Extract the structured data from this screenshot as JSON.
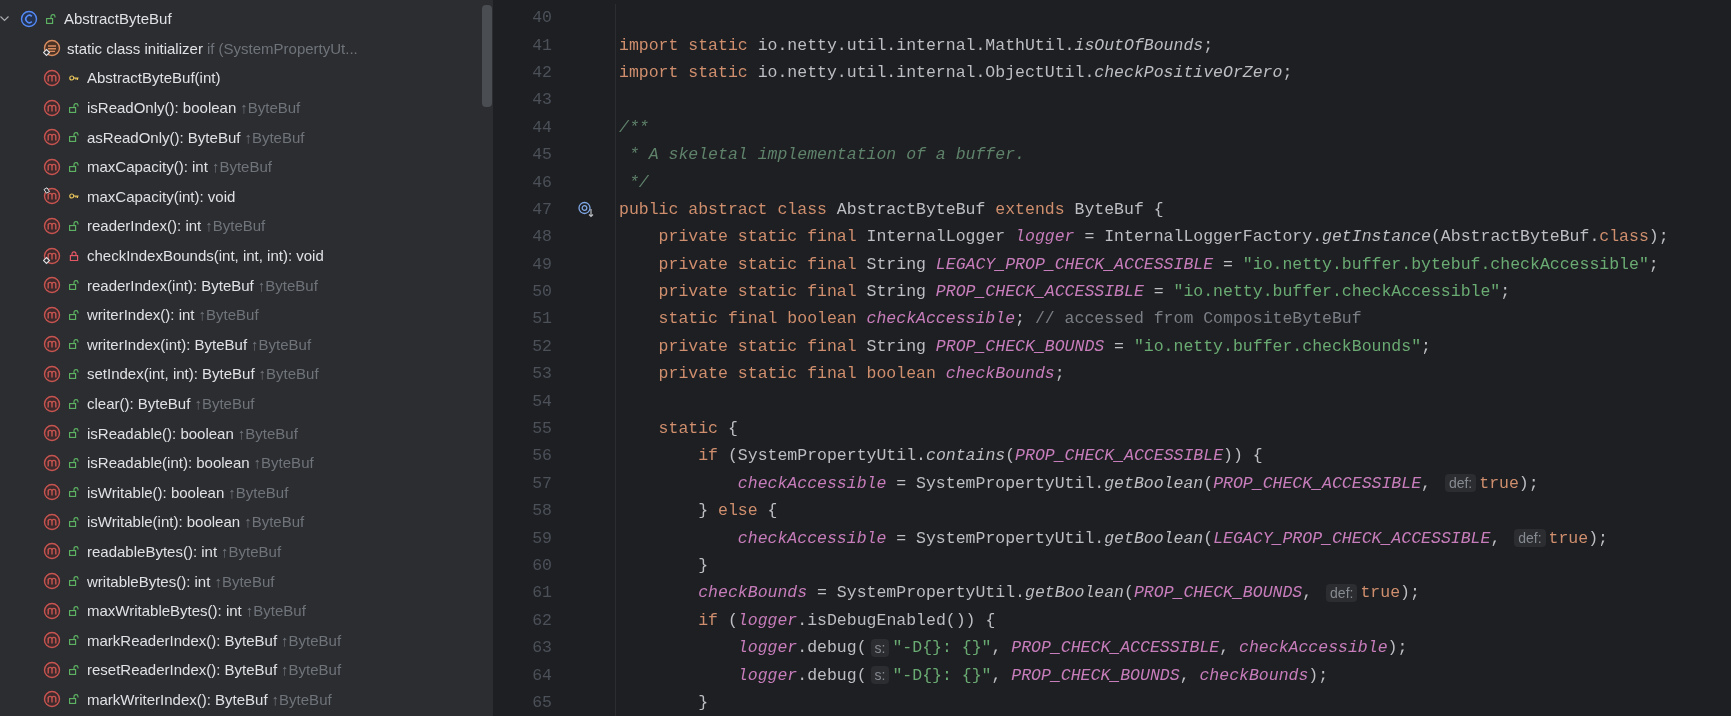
{
  "structure": {
    "root": {
      "name": "AbstractByteBuf",
      "kind": "class",
      "public": true,
      "private": false,
      "expanded": true,
      "children": [
        {
          "name": "static class initializer",
          "kind": "initializer",
          "static": true,
          "pinned": false,
          "detail": "if (SystemPropertyUt..."
        },
        {
          "name": "AbstractByteBuf(int)",
          "kind": "method",
          "public": false,
          "private": false,
          "static": false,
          "pinned": false
        },
        {
          "name": "isReadOnly(): boolean",
          "kind": "method",
          "public": true,
          "private": false,
          "static": false,
          "pinned": false,
          "detail": "↑ByteBuf"
        },
        {
          "name": "asReadOnly(): ByteBuf",
          "kind": "method",
          "public": true,
          "private": false,
          "static": false,
          "pinned": false,
          "detail": "↑ByteBuf"
        },
        {
          "name": "maxCapacity(): int",
          "kind": "method",
          "public": true,
          "private": false,
          "static": false,
          "pinned": false,
          "detail": "↑ByteBuf"
        },
        {
          "name": "maxCapacity(int): void",
          "kind": "method",
          "public": false,
          "private": false,
          "static": false,
          "pinned": true
        },
        {
          "name": "readerIndex(): int",
          "kind": "method",
          "public": true,
          "private": false,
          "static": false,
          "pinned": false,
          "detail": "↑ByteBuf"
        },
        {
          "name": "checkIndexBounds(int, int, int): void",
          "kind": "method",
          "public": false,
          "private": true,
          "static": true,
          "pinned": false
        },
        {
          "name": "readerIndex(int): ByteBuf",
          "kind": "method",
          "public": true,
          "private": false,
          "static": false,
          "pinned": false,
          "detail": "↑ByteBuf"
        },
        {
          "name": "writerIndex(): int",
          "kind": "method",
          "public": true,
          "private": false,
          "static": false,
          "pinned": false,
          "detail": "↑ByteBuf"
        },
        {
          "name": "writerIndex(int): ByteBuf",
          "kind": "method",
          "public": true,
          "private": false,
          "static": false,
          "pinned": false,
          "detail": "↑ByteBuf"
        },
        {
          "name": "setIndex(int, int): ByteBuf",
          "kind": "method",
          "public": true,
          "private": false,
          "static": false,
          "pinned": false,
          "detail": "↑ByteBuf"
        },
        {
          "name": "clear(): ByteBuf",
          "kind": "method",
          "public": true,
          "private": false,
          "static": false,
          "pinned": false,
          "detail": "↑ByteBuf"
        },
        {
          "name": "isReadable(): boolean",
          "kind": "method",
          "public": true,
          "private": false,
          "static": false,
          "pinned": false,
          "detail": "↑ByteBuf"
        },
        {
          "name": "isReadable(int): boolean",
          "kind": "method",
          "public": true,
          "private": false,
          "static": false,
          "pinned": false,
          "detail": "↑ByteBuf"
        },
        {
          "name": "isWritable(): boolean",
          "kind": "method",
          "public": true,
          "private": false,
          "static": false,
          "pinned": false,
          "detail": "↑ByteBuf"
        },
        {
          "name": "isWritable(int): boolean",
          "kind": "method",
          "public": true,
          "private": false,
          "static": false,
          "pinned": false,
          "detail": "↑ByteBuf"
        },
        {
          "name": "readableBytes(): int",
          "kind": "method",
          "public": true,
          "private": false,
          "static": false,
          "pinned": false,
          "detail": "↑ByteBuf"
        },
        {
          "name": "writableBytes(): int",
          "kind": "method",
          "public": true,
          "private": false,
          "static": false,
          "pinned": false,
          "detail": "↑ByteBuf"
        },
        {
          "name": "maxWritableBytes(): int",
          "kind": "method",
          "public": true,
          "private": false,
          "static": false,
          "pinned": false,
          "detail": "↑ByteBuf"
        },
        {
          "name": "markReaderIndex(): ByteBuf",
          "kind": "method",
          "public": true,
          "private": false,
          "static": false,
          "pinned": false,
          "detail": "↑ByteBuf"
        },
        {
          "name": "resetReaderIndex(): ByteBuf",
          "kind": "method",
          "public": true,
          "private": false,
          "static": false,
          "pinned": false,
          "detail": "↑ByteBuf"
        },
        {
          "name": "markWriterIndex(): ByteBuf",
          "kind": "method",
          "public": true,
          "private": false,
          "static": false,
          "pinned": false,
          "detail": "↑ByteBuf"
        }
      ]
    }
  },
  "editor": {
    "lines": [
      {
        "number": "40"
      },
      {
        "number": "41",
        "tokens": [
          {
            "kind": "keyword",
            "text": "import static "
          },
          {
            "kind": "plain",
            "text": "io.netty.util.internal.MathUtil."
          },
          {
            "kind": "static_call",
            "text": "isOutOfBounds"
          },
          {
            "kind": "plain",
            "text": ";"
          }
        ]
      },
      {
        "number": "42",
        "tokens": [
          {
            "kind": "keyword",
            "text": "import static "
          },
          {
            "kind": "plain",
            "text": "io.netty.util.internal.ObjectUtil."
          },
          {
            "kind": "static_call",
            "text": "checkPositiveOrZero"
          },
          {
            "kind": "plain",
            "text": ";"
          }
        ]
      },
      {
        "number": "43"
      },
      {
        "number": "44",
        "tokens": [
          {
            "kind": "doc",
            "text": "/**"
          }
        ]
      },
      {
        "number": "45",
        "tokens": [
          {
            "kind": "doc",
            "text": " * A skeletal implementation of a buffer."
          }
        ]
      },
      {
        "number": "46",
        "tokens": [
          {
            "kind": "doc",
            "text": " */"
          }
        ]
      },
      {
        "number": "47",
        "gutter_icon": true,
        "tokens": [
          {
            "kind": "keyword",
            "text": "public abstract class "
          },
          {
            "kind": "plain",
            "text": "AbstractByteBuf "
          },
          {
            "kind": "keyword",
            "text": "extends "
          },
          {
            "kind": "plain",
            "text": "ByteBuf {"
          }
        ]
      },
      {
        "number": "48",
        "tokens": [
          {
            "kind": "keyword",
            "text": "    private static final "
          },
          {
            "kind": "plain",
            "text": "InternalLogger "
          },
          {
            "kind": "field",
            "text": "logger"
          },
          {
            "kind": "plain",
            "text": " = InternalLoggerFactory."
          },
          {
            "kind": "static_call",
            "text": "getInstance"
          },
          {
            "kind": "plain",
            "text": "(AbstractByteBuf."
          },
          {
            "kind": "keyword",
            "text": "class"
          },
          {
            "kind": "plain",
            "text": ");"
          }
        ]
      },
      {
        "number": "49",
        "tokens": [
          {
            "kind": "keyword",
            "text": "    private static final "
          },
          {
            "kind": "plain",
            "text": "String "
          },
          {
            "kind": "field",
            "text": "LEGACY_PROP_CHECK_ACCESSIBLE"
          },
          {
            "kind": "plain",
            "text": " = "
          },
          {
            "kind": "string",
            "text": "\"io.netty.buffer.bytebuf.checkAccessible\""
          },
          {
            "kind": "plain",
            "text": ";"
          }
        ]
      },
      {
        "number": "50",
        "tokens": [
          {
            "kind": "keyword",
            "text": "    private static final "
          },
          {
            "kind": "plain",
            "text": "String "
          },
          {
            "kind": "field",
            "text": "PROP_CHECK_ACCESSIBLE"
          },
          {
            "kind": "plain",
            "text": " = "
          },
          {
            "kind": "string",
            "text": "\"io.netty.buffer.checkAccessible\""
          },
          {
            "kind": "plain",
            "text": ";"
          }
        ]
      },
      {
        "number": "51",
        "tokens": [
          {
            "kind": "keyword",
            "text": "    static final boolean "
          },
          {
            "kind": "field",
            "text": "checkAccessible"
          },
          {
            "kind": "plain",
            "text": "; "
          },
          {
            "kind": "comment",
            "text": "// accessed from CompositeByteBuf"
          }
        ]
      },
      {
        "number": "52",
        "tokens": [
          {
            "kind": "keyword",
            "text": "    private static final "
          },
          {
            "kind": "plain",
            "text": "String "
          },
          {
            "kind": "field",
            "text": "PROP_CHECK_BOUNDS"
          },
          {
            "kind": "plain",
            "text": " = "
          },
          {
            "kind": "string",
            "text": "\"io.netty.buffer.checkBounds\""
          },
          {
            "kind": "plain",
            "text": ";"
          }
        ]
      },
      {
        "number": "53",
        "tokens": [
          {
            "kind": "keyword",
            "text": "    private static final boolean "
          },
          {
            "kind": "field",
            "text": "checkBounds"
          },
          {
            "kind": "plain",
            "text": ";"
          }
        ]
      },
      {
        "number": "54"
      },
      {
        "number": "55",
        "tokens": [
          {
            "kind": "keyword",
            "text": "    static "
          },
          {
            "kind": "plain",
            "text": "{"
          }
        ]
      },
      {
        "number": "56",
        "tokens": [
          {
            "kind": "keyword",
            "text": "        if "
          },
          {
            "kind": "plain",
            "text": "(SystemPropertyUtil."
          },
          {
            "kind": "static_call",
            "text": "contains"
          },
          {
            "kind": "plain",
            "text": "("
          },
          {
            "kind": "field",
            "text": "PROP_CHECK_ACCESSIBLE"
          },
          {
            "kind": "plain",
            "text": ")) {"
          }
        ]
      },
      {
        "number": "57",
        "tokens": [
          {
            "kind": "field",
            "text": "            checkAccessible"
          },
          {
            "kind": "plain",
            "text": " = SystemPropertyUtil."
          },
          {
            "kind": "static_call",
            "text": "getBoolean"
          },
          {
            "kind": "plain",
            "text": "("
          },
          {
            "kind": "field",
            "text": "PROP_CHECK_ACCESSIBLE"
          },
          {
            "kind": "plain",
            "text": ", "
          },
          {
            "kind": "hint",
            "text": "def:"
          },
          {
            "kind": "keyword",
            "text": "true"
          },
          {
            "kind": "plain",
            "text": ");"
          }
        ]
      },
      {
        "number": "58",
        "tokens": [
          {
            "kind": "plain",
            "text": "        } "
          },
          {
            "kind": "keyword",
            "text": "else "
          },
          {
            "kind": "plain",
            "text": "{"
          }
        ]
      },
      {
        "number": "59",
        "tokens": [
          {
            "kind": "field",
            "text": "            checkAccessible"
          },
          {
            "kind": "plain",
            "text": " = SystemPropertyUtil."
          },
          {
            "kind": "static_call",
            "text": "getBoolean"
          },
          {
            "kind": "plain",
            "text": "("
          },
          {
            "kind": "field",
            "text": "LEGACY_PROP_CHECK_ACCESSIBLE"
          },
          {
            "kind": "plain",
            "text": ", "
          },
          {
            "kind": "hint",
            "text": "def:"
          },
          {
            "kind": "keyword",
            "text": "true"
          },
          {
            "kind": "plain",
            "text": ");"
          }
        ]
      },
      {
        "number": "60",
        "tokens": [
          {
            "kind": "plain",
            "text": "        }"
          }
        ]
      },
      {
        "number": "61",
        "tokens": [
          {
            "kind": "field",
            "text": "        checkBounds"
          },
          {
            "kind": "plain",
            "text": " = SystemPropertyUtil."
          },
          {
            "kind": "static_call",
            "text": "getBoolean"
          },
          {
            "kind": "plain",
            "text": "("
          },
          {
            "kind": "field",
            "text": "PROP_CHECK_BOUNDS"
          },
          {
            "kind": "plain",
            "text": ", "
          },
          {
            "kind": "hint",
            "text": "def:"
          },
          {
            "kind": "keyword",
            "text": "true"
          },
          {
            "kind": "plain",
            "text": ");"
          }
        ]
      },
      {
        "number": "62",
        "tokens": [
          {
            "kind": "keyword",
            "text": "        if "
          },
          {
            "kind": "plain",
            "text": "("
          },
          {
            "kind": "field",
            "text": "logger"
          },
          {
            "kind": "plain",
            "text": ".isDebugEnabled()) {"
          }
        ]
      },
      {
        "number": "63",
        "tokens": [
          {
            "kind": "field",
            "text": "            logger"
          },
          {
            "kind": "plain",
            "text": ".debug("
          },
          {
            "kind": "hint",
            "text": "s:"
          },
          {
            "kind": "string",
            "text": "\"-D{}: {}\""
          },
          {
            "kind": "plain",
            "text": ", "
          },
          {
            "kind": "field",
            "text": "PROP_CHECK_ACCESSIBLE"
          },
          {
            "kind": "plain",
            "text": ", "
          },
          {
            "kind": "field",
            "text": "checkAccessible"
          },
          {
            "kind": "plain",
            "text": ");"
          }
        ]
      },
      {
        "number": "64",
        "tokens": [
          {
            "kind": "field",
            "text": "            logger"
          },
          {
            "kind": "plain",
            "text": ".debug("
          },
          {
            "kind": "hint",
            "text": "s:"
          },
          {
            "kind": "string",
            "text": "\"-D{}: {}\""
          },
          {
            "kind": "plain",
            "text": ", "
          },
          {
            "kind": "field",
            "text": "PROP_CHECK_BOUNDS"
          },
          {
            "kind": "plain",
            "text": ", "
          },
          {
            "kind": "field",
            "text": "checkBounds"
          },
          {
            "kind": "plain",
            "text": ");"
          }
        ]
      },
      {
        "number": "65",
        "tokens": [
          {
            "kind": "plain",
            "text": "        }"
          }
        ]
      }
    ]
  }
}
